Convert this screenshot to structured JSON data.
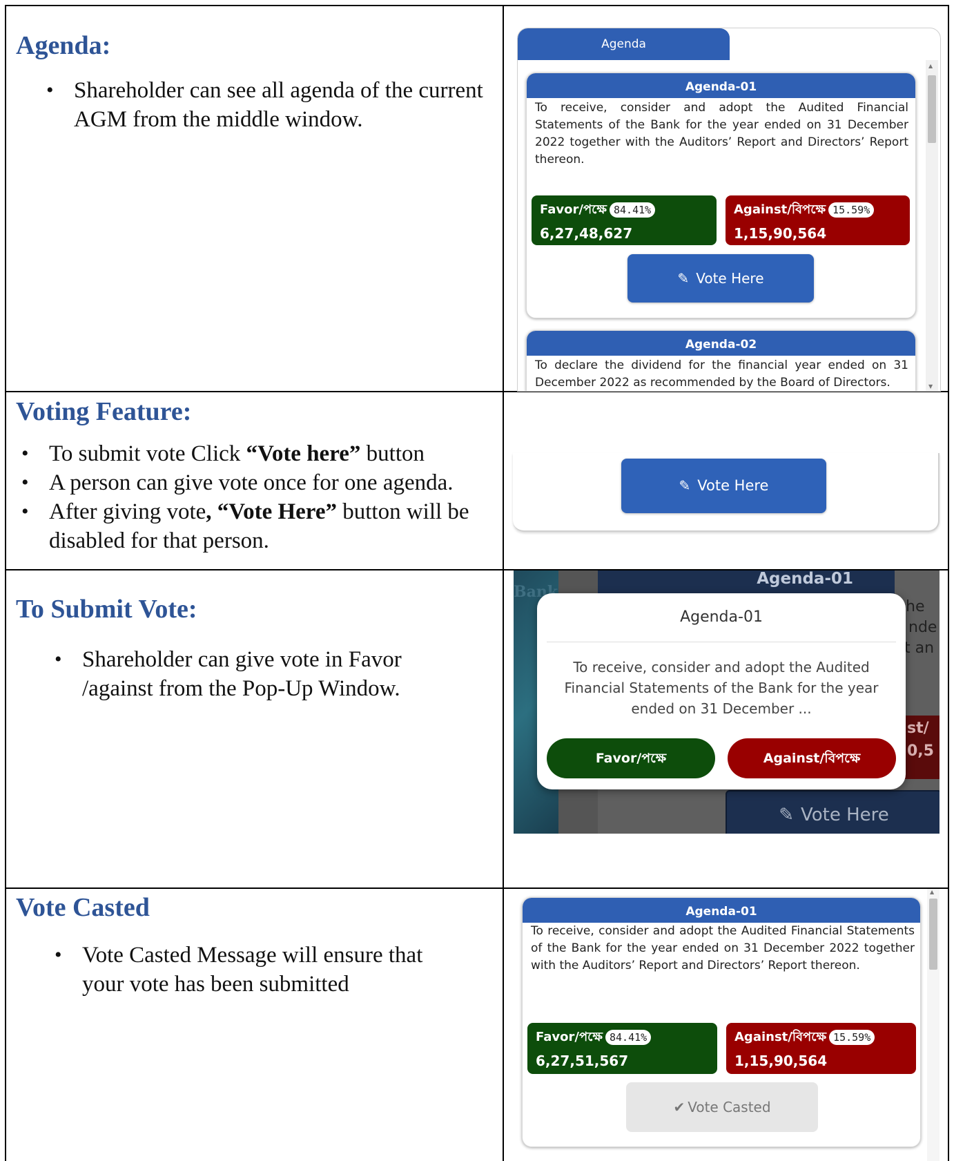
{
  "sections": [
    {
      "heading": "Agenda:",
      "bullets": [
        "Shareholder can see all agenda of the current AGM from the middle window."
      ]
    },
    {
      "heading": "Voting Feature:",
      "bullets": {
        "b1_pre": "To submit vote Click ",
        "b1_bold": "“Vote here”",
        "b1_post": " button",
        "b2": "A person can give vote once for one agenda.",
        "b3_pre": "After giving vote",
        "b3_bold": ", “Vote Here”",
        "b3_post": " button will be disabled for that person."
      }
    },
    {
      "heading": "To Submit Vote:",
      "bullets": [
        "Shareholder can give vote in Favor /against from the Pop-Up Window."
      ]
    },
    {
      "heading": "Vote Casted",
      "bullets": [
        "Vote Casted Message will ensure that your vote has been submitted"
      ]
    }
  ],
  "panel1": {
    "tab_label": "Agenda",
    "agenda1": {
      "title": "Agenda-01",
      "text": "To receive, consider and adopt the Audited Financial Statements of the Bank for the year ended on 31 December 2022 together with the Auditors’ Report and Directors’ Report thereon.",
      "favor_label": "Favor/পক্ষে",
      "favor_pct": "84.41%",
      "favor_count": "6,27,48,627",
      "against_label": "Against/বিপক্ষে",
      "against_pct": "15.59%",
      "against_count": "1,15,90,564",
      "vote_label": "Vote Here"
    },
    "agenda2": {
      "title": "Agenda-02",
      "text": "To declare the dividend for the financial year ended on 31 December 2022 as recommended by the Board of Directors."
    }
  },
  "panel2": {
    "vote_label": "Vote Here"
  },
  "panel3": {
    "bg_title": "Agenda-01",
    "bg_word": "Bank",
    "bg_frag1": "he",
    "bg_frag2": "nde",
    "bg_frag3": "t an",
    "bg_frag4": "st/",
    "bg_frag5": "0,5",
    "bg_vote_label": "Vote Here",
    "modal_title": "Agenda-01",
    "modal_text": "To receive, consider and adopt the Audited Financial Statements of the Bank for the year ended on 31 December ...",
    "favor_btn": "Favor/পক্ষে",
    "against_btn": "Against/বিপক্ষে"
  },
  "panel4": {
    "title": "Agenda-01",
    "text": "To receive, consider and adopt the Audited Financial Statements of the Bank for the year ended on 31 December 2022 together with the Auditors’ Report and Directors’ Report thereon.",
    "favor_label": "Favor/পক্ষে",
    "favor_pct": "84.41%",
    "favor_count": "6,27,51,567",
    "against_label": "Against/বিপক্ষে",
    "against_pct": "15.59%",
    "against_count": "1,15,90,564",
    "casted_label": "Vote Casted"
  },
  "colors": {
    "heading": "#2e5496",
    "primary": "#2f5fb3",
    "favor": "#0d4d0b",
    "against": "#990000"
  }
}
